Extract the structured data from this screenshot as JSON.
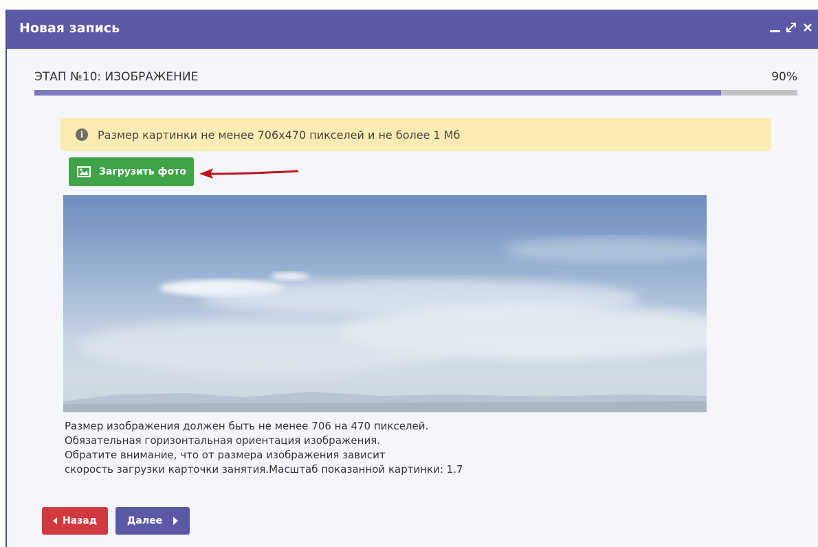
{
  "window": {
    "title": "Новая запись"
  },
  "stage": {
    "label": "ЭТАП №10: ИЗОБРАЖЕНИЕ",
    "percent_text": "90%",
    "progress": 0.9
  },
  "alert": {
    "icon": "info-icon",
    "text": "Размер картинки не менее 706x470 пикселей и не более 1 Мб"
  },
  "upload": {
    "icon": "image-icon",
    "label": "Загрузить фото"
  },
  "description": [
    "Размер изображения должен быть не менее 706 на 470 пикселей.",
    "Обязательная горизонтальная ориентация изображения.",
    "Обратите внимание, что от размера изображения зависит",
    "скорость загрузки карточки занятия.Масштаб показанной картинки: 1.7"
  ],
  "nav": {
    "back_label": "Назад",
    "next_label": "Далее"
  },
  "colors": {
    "header": "#5b58a6",
    "progress_fill": "#7a79bd",
    "alert_bg": "#fdebb4",
    "upload_btn": "#3fa447",
    "back_btn": "#d2393f",
    "next_btn": "#5b58a6",
    "arrow": "#c0121b"
  }
}
